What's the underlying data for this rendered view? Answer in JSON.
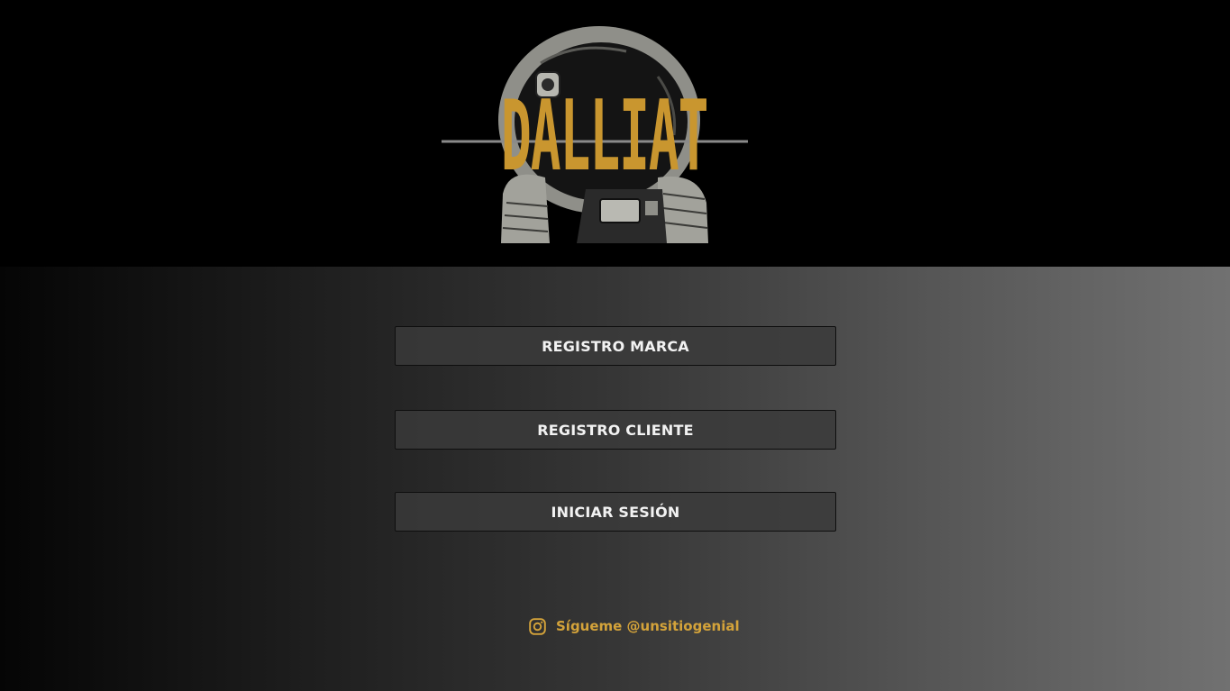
{
  "header": {
    "logo": {
      "brand": "DALLIAT",
      "icon": "astronaut-helmet-illustration",
      "colors": {
        "text": "#c9962f",
        "illustration": "#9a9a93"
      }
    }
  },
  "main": {
    "buttons": [
      {
        "label": "REGISTRO MARCA"
      },
      {
        "label": "REGISTRO CLIENTE"
      },
      {
        "label": "INICIAR SESIÓN"
      }
    ],
    "social": {
      "icon": "instagram-icon",
      "text": "Sígueme @unsitiogenial",
      "color": "#d4a33a"
    }
  }
}
